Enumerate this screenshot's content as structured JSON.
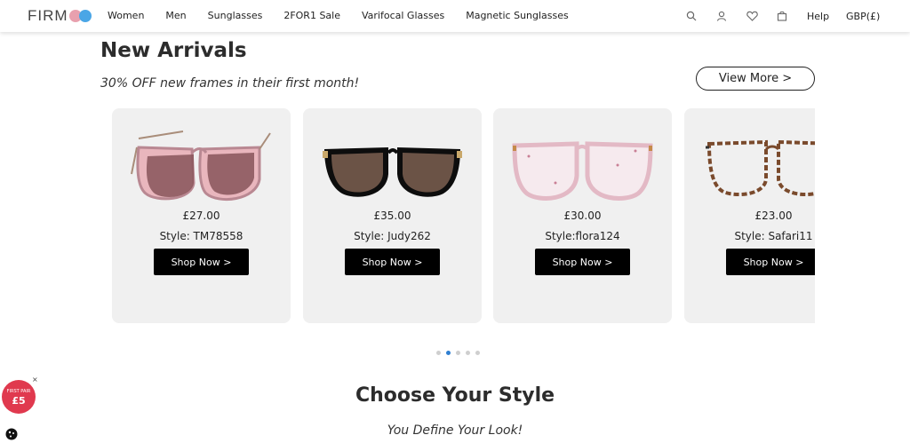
{
  "header": {
    "logo_text": "FIRM",
    "nav": [
      "Women",
      "Men",
      "Sunglasses",
      "2FOR1 Sale",
      "Varifocal Glasses",
      "Magnetic Sunglasses"
    ],
    "help": "Help",
    "currency": "GBP(£)",
    "icons": [
      "search-icon",
      "user-icon",
      "heart-icon",
      "bag-icon"
    ]
  },
  "new_arrivals": {
    "title": "New Arrivals",
    "subtitle": "30% OFF new frames in their first month!",
    "view_more": "View More >",
    "products": [
      {
        "price": "£27.00",
        "style": "Style: TM78558",
        "cta": "Shop Now >"
      },
      {
        "price": "£35.00",
        "style": "Style: Judy262",
        "cta": "Shop Now >"
      },
      {
        "price": "£30.00",
        "style": "Style:flora124",
        "cta": "Shop Now >"
      },
      {
        "price": "£23.00",
        "style": "Style: Safari11",
        "cta": "Shop Now >"
      }
    ],
    "pagination": {
      "count": 5,
      "active": 2
    }
  },
  "choose_style": {
    "title": "Choose Your Style",
    "subtitle": "You Define Your Look!"
  },
  "promo": {
    "line1": "FIRST PAIR",
    "line2": "£5",
    "close": "×"
  },
  "colors": {
    "accent_blue": "#2f7fd1",
    "promo_red": "#e0394e",
    "logo_pink": "#e8a0ae",
    "logo_blue": "#4aa6e6"
  }
}
